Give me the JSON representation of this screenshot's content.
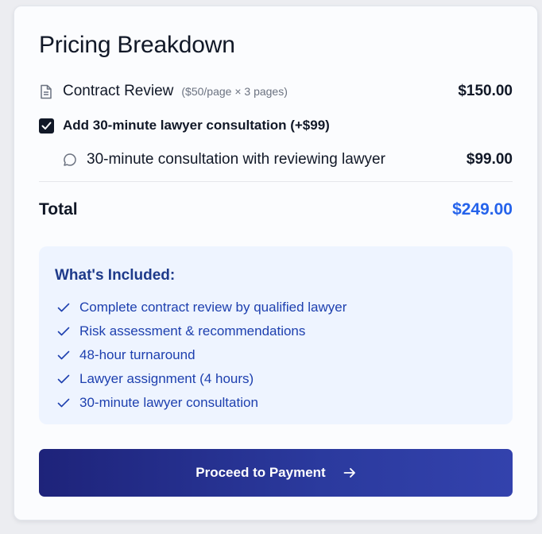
{
  "title": "Pricing Breakdown",
  "line_item": {
    "icon": "document-icon",
    "label": "Contract Review",
    "note": "($50/page × 3 pages)",
    "price": "$150.00"
  },
  "addon": {
    "checked": true,
    "label": "Add 30-minute lawyer consultation (+$99)"
  },
  "addon_item": {
    "icon": "chat-bubble-icon",
    "label": "30-minute consultation with reviewing lawyer",
    "price": "$99.00"
  },
  "total": {
    "label": "Total",
    "value": "$249.00",
    "color": "#2563eb"
  },
  "included": {
    "title": "What's Included:",
    "items": [
      "Complete contract review by qualified lawyer",
      "Risk assessment & recommendations",
      "48-hour turnaround",
      "Lawyer assignment (4 hours)",
      "30-minute lawyer consultation"
    ]
  },
  "cta": {
    "label": "Proceed to Payment",
    "icon": "arrow-right-icon"
  }
}
